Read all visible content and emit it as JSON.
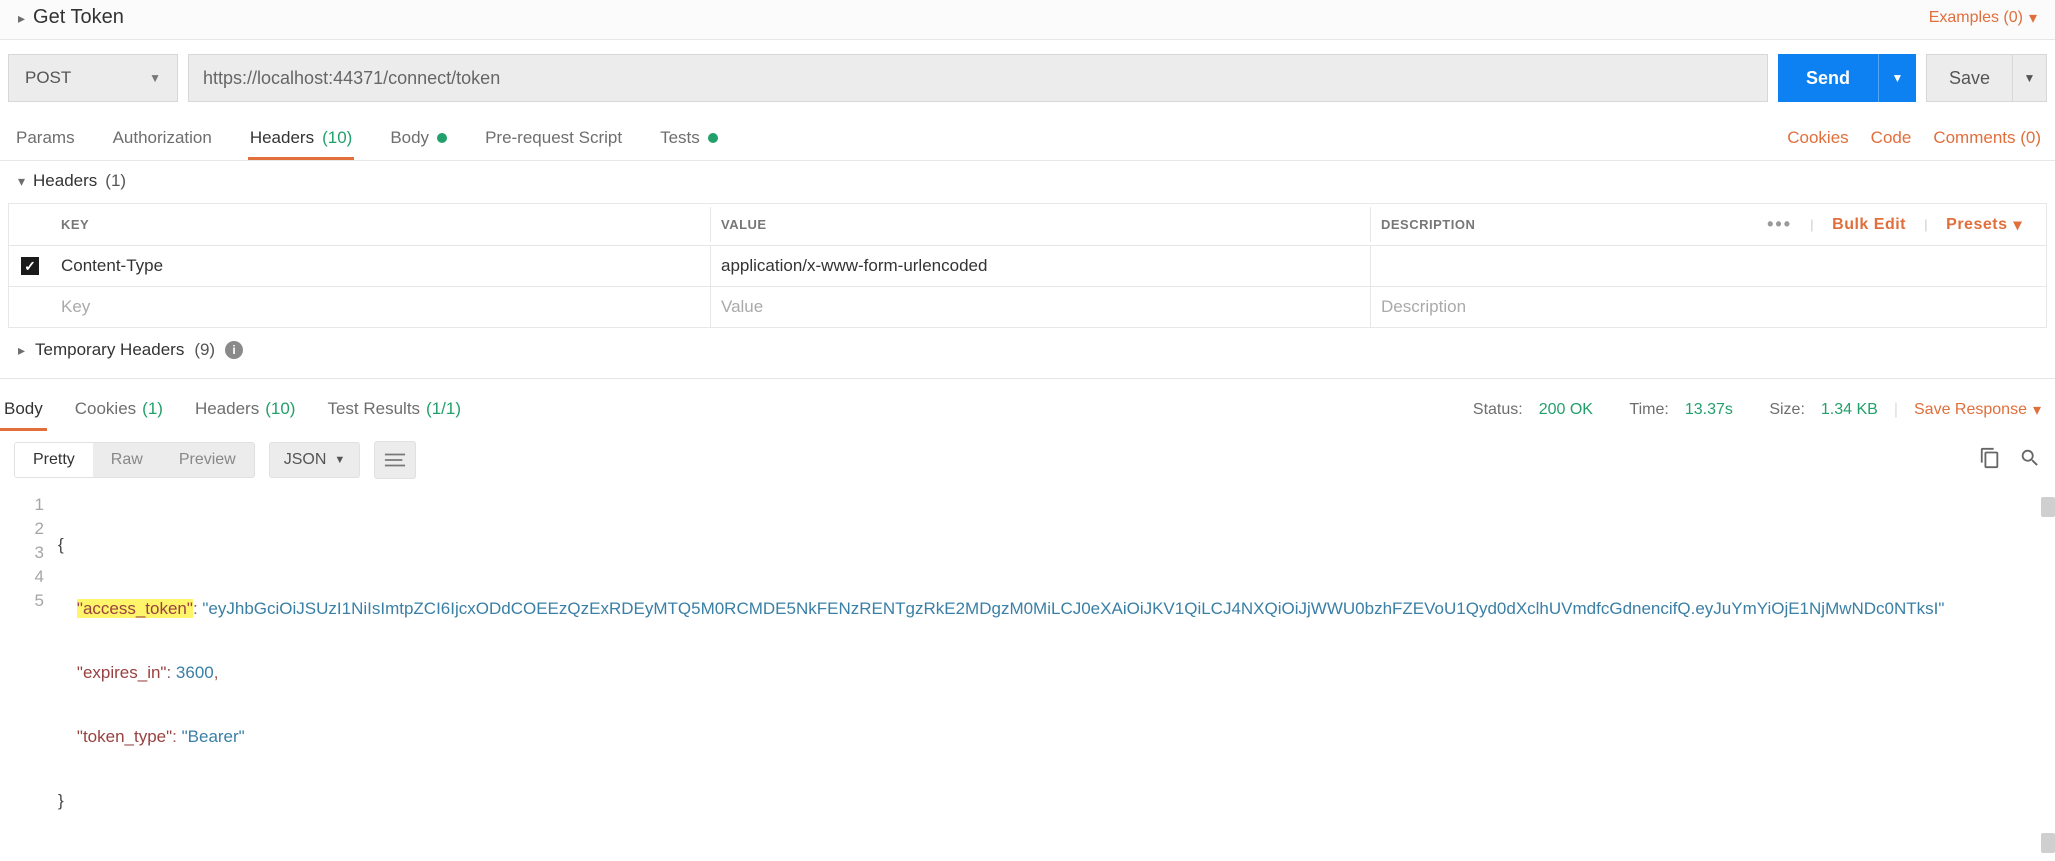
{
  "title": {
    "name": "Get Token",
    "examples_label": "Examples (0)"
  },
  "request": {
    "method": "POST",
    "url": "https://localhost:44371/connect/token",
    "send_label": "Send",
    "save_label": "Save"
  },
  "req_tabs": {
    "params": "Params",
    "authorization": "Authorization",
    "headers_label": "Headers",
    "headers_count": "(10)",
    "body_label": "Body",
    "prerequest": "Pre-request Script",
    "tests": "Tests"
  },
  "req_links": {
    "cookies": "Cookies",
    "code": "Code",
    "comments": "Comments (0)"
  },
  "headers_section": {
    "title": "Headers",
    "count": "(1)"
  },
  "headers_table": {
    "col_key": "KEY",
    "col_value": "VALUE",
    "col_desc": "DESCRIPTION",
    "bulk_edit": "Bulk Edit",
    "presets": "Presets",
    "rows": [
      {
        "checked": true,
        "key": "Content-Type",
        "value": "application/x-www-form-urlencoded",
        "desc": ""
      }
    ],
    "placeholder_key": "Key",
    "placeholder_value": "Value",
    "placeholder_desc": "Description"
  },
  "temp_headers": {
    "label": "Temporary Headers",
    "count": "(9)"
  },
  "response": {
    "tabs": {
      "body": "Body",
      "cookies_label": "Cookies",
      "cookies_count": "(1)",
      "headers_label": "Headers",
      "headers_count": "(10)",
      "testresults_label": "Test Results",
      "testresults_count": "(1/1)"
    },
    "status_label": "Status:",
    "status_value": "200 OK",
    "time_label": "Time:",
    "time_value": "13.37s",
    "size_label": "Size:",
    "size_value": "1.34 KB",
    "save_response": "Save Response"
  },
  "body_toolbar": {
    "pretty": "Pretty",
    "raw": "Raw",
    "preview": "Preview",
    "format": "JSON"
  },
  "json_body": {
    "access_token_key": "\"access_token\"",
    "access_token_val": "\"eyJhbGciOiJSUzI1NiIsImtpZCI6IjcxODdCOEEzQzExRDEyMTQ5M0RCMDE5NkFENzRENTgzRkE2MDgzM0MiLCJ0eXAiOiJKV1QiLCJ4NXQiOiJjWWU0bzhFZEVoU1Qyd0dXclhUVmdfcGdnencifQ.eyJuYmYiOjE1NjMwNDc0NTksI\"",
    "expires_in_key": "\"expires_in\"",
    "expires_in_val": "3600",
    "token_type_key": "\"token_type\"",
    "token_type_val": "\"Bearer\""
  }
}
